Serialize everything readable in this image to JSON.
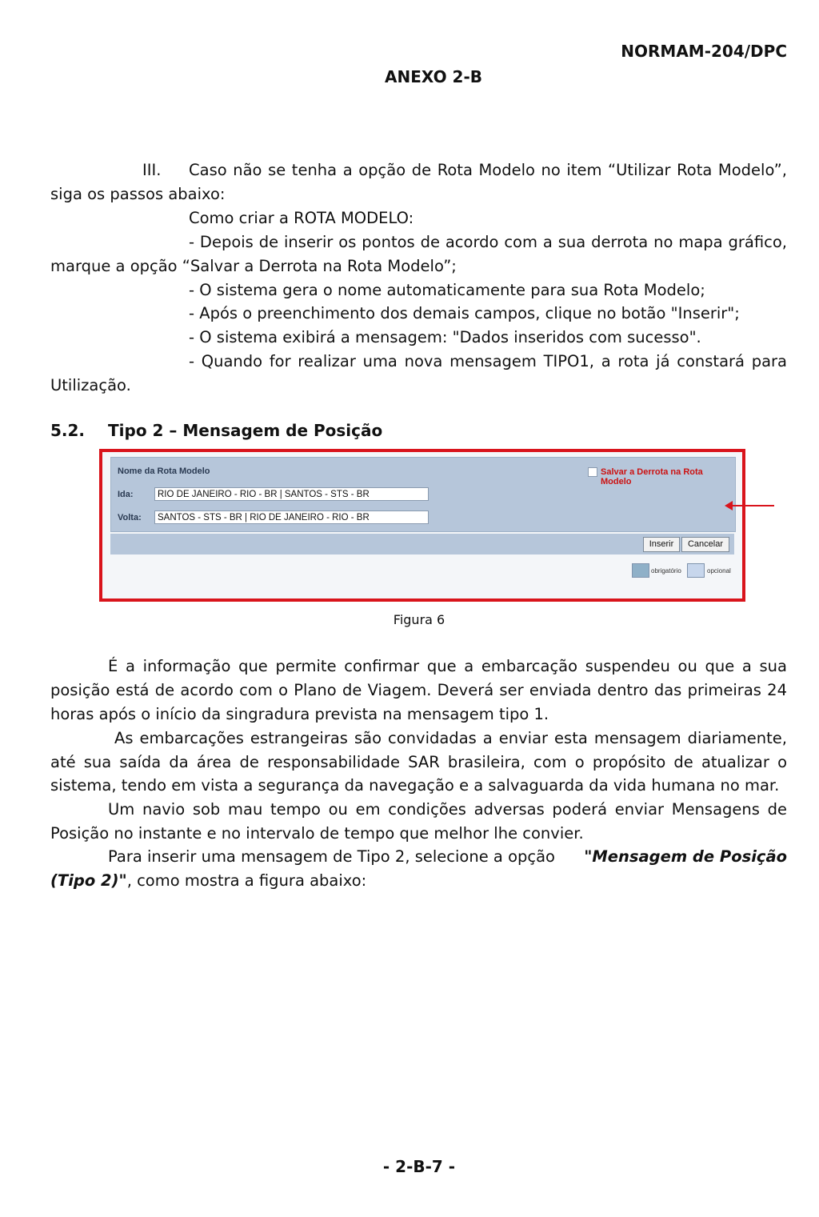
{
  "header": {
    "doc_code": "NORMAM-204/DPC",
    "annex": "ANEXO 2-B"
  },
  "section_iii": {
    "numeral": "III.",
    "line1": "Caso não se tenha a opção de Rota Modelo no item “Utilizar Rota Modelo”,",
    "line2": "siga os passos abaixo:",
    "how_to": "Como criar a ROTA MODELO:",
    "step1_a": "- Depois de inserir os pontos de acordo com a sua derrota no mapa gráfico,",
    "step1_b": "marque a opção “Salvar a Derrota na Rota Modelo”;",
    "step2": "- O sistema gera o nome automaticamente para sua Rota Modelo;",
    "step3": "- Após o preenchimento dos demais campos, clique no botão \"Inserir\";",
    "step4": "- O sistema exibirá a mensagem: \"Dados inseridos com sucesso\".",
    "step5_a": "- Quando for realizar uma nova mensagem TIPO1, a rota já constará para",
    "step5_b": "Utilização."
  },
  "section_52": {
    "number": "5.2.",
    "title": "Tipo 2 – Mensagem de Posição"
  },
  "figure": {
    "panel_title": "Nome da Rota Modelo",
    "checkbox_label": "Salvar a Derrota na Rota Modelo",
    "ida_label": "Ida:",
    "ida_value": "RIO DE JANEIRO - RIO - BR | SANTOS - STS - BR",
    "volta_label": "Volta:",
    "volta_value": "SANTOS - STS - BR | RIO DE JANEIRO - RIO - BR",
    "insert_button": "Inserir",
    "cancel_button": "Cancelar",
    "legend_required": "obrigatório",
    "legend_optional": "opcional",
    "legend_required_color": "#8fb0c8",
    "legend_optional_color": "#c7d6ec",
    "caption": "Figura 6"
  },
  "body": {
    "p1_a": "É a informação que permite confirmar que a embarcação suspendeu ou que a sua",
    "p1_b": "posição está de acordo com o Plano de Viagem. Deverá ser enviada dentro das primeiras 24",
    "p1_c": "horas após o início da singradura prevista na mensagem tipo 1.",
    "p2_a": "As embarcações estrangeiras são convidadas a enviar esta mensagem diariamente,",
    "p2_b": "até sua saída da área de responsabilidade SAR brasileira, com o propósito de atualizar o",
    "p2_c": "sistema, tendo em vista a segurança da navegação e a salvaguarda da vida humana no mar.",
    "p3_a": "Um navio sob mau tempo ou em condições adversas poderá enviar Mensagens de",
    "p3_b": "Posição no instante e no intervalo de tempo que melhor lhe convier.",
    "p4_a_plain": "Para inserir uma mensagem de Tipo 2, selecione a opção",
    "p4_a_bold": "\"Mensagem de Posição",
    "p4_b_bold": "(Tipo 2)\"",
    "p4_b_plain": ", como mostra a figura abaixo:"
  },
  "footer": {
    "page_number": "- 2-B-7 -"
  }
}
